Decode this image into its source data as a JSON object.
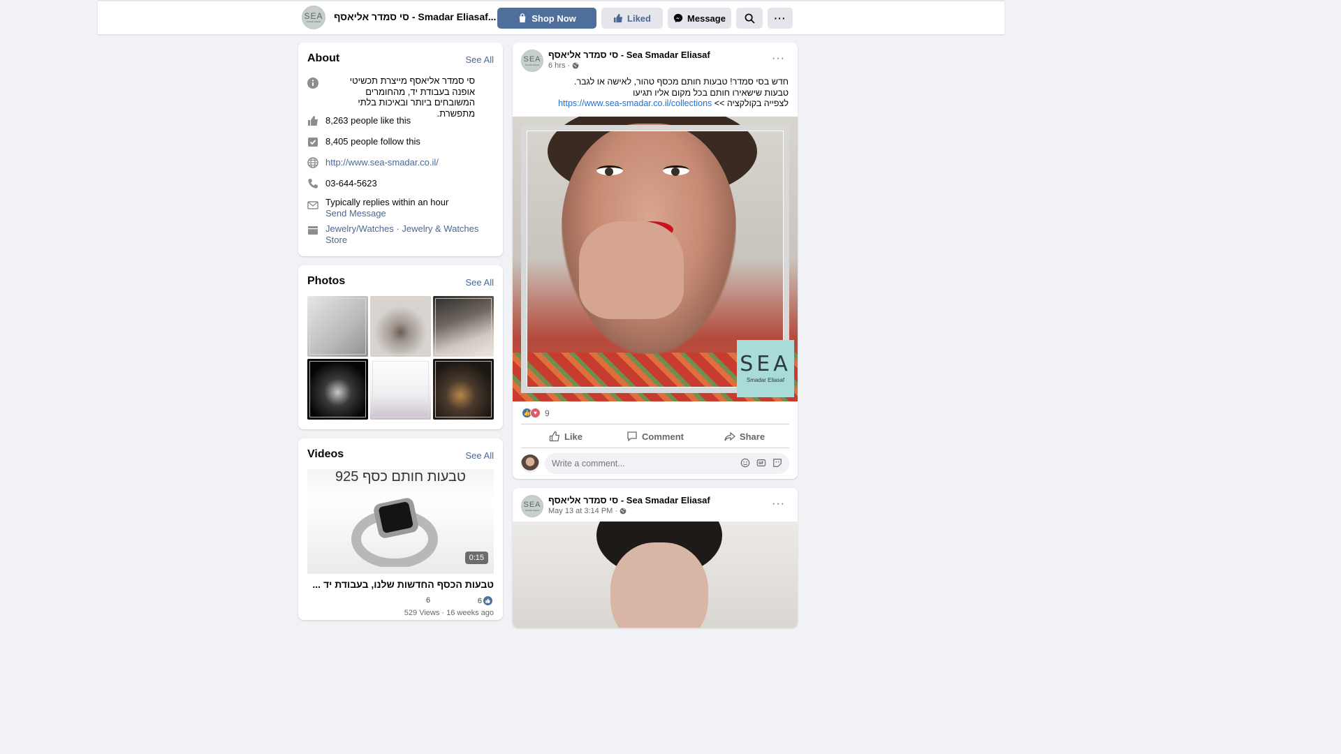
{
  "header": {
    "page_name": "סי סמדר אליאסף - Smadar Eliasaf...",
    "avatar_text": "SEA",
    "avatar_sub": "Smadar Eliasaf",
    "buttons": {
      "shop": "Shop Now",
      "liked": "Liked",
      "message": "Message"
    },
    "accent_color": "#4e6f9b"
  },
  "about": {
    "title": "About",
    "see_all": "See All",
    "description": "סי סמדר אליאסף מייצרת תכשיטי אופנה בעבודת יד, מהחומרים המשובחים ביותר ובאיכות בלתי מתפשרת.",
    "likes": "8,263 people like this",
    "follows": "8,405 people follow this",
    "website": "http://www.sea-smadar.co.il/",
    "phone": "03-644-5623",
    "reply": "Typically replies within an hour",
    "send_message": "Send Message",
    "category_1": "Jewelry/Watches",
    "category_sep": " · ",
    "category_2": "Jewelry & Watches Store"
  },
  "photos": {
    "title": "Photos",
    "see_all": "See All"
  },
  "videos": {
    "title": "Videos",
    "see_all": "See All",
    "thumb_text": "טבעות חותם כסף 925",
    "duration": "0:15",
    "video_title": "טבעות הכסף החדשות שלנו, בעבודת יד ...",
    "likes": "6",
    "comments": "6",
    "stats": "529 Views · 16 weeks ago"
  },
  "post1": {
    "author": "סי סמדר אליאסף - Sea Smadar Eliasaf",
    "time": "6 hrs",
    "line1": "חדש בסי סמדר! טבעות חותם מכסף טהור, לאישה או לגבר.",
    "line2": "טבעות שישאירו חותם בכל מקום אליו תגיעו",
    "line3_prefix": "לצפייה בקולקציה >> ",
    "link": "https://www.sea-smadar.co.il/collections",
    "image_logo": "SEA",
    "image_logo_sub": "Smadar Eliasaf",
    "reaction_count": "9",
    "actions": {
      "like": "Like",
      "comment": "Comment",
      "share": "Share"
    },
    "comment_placeholder": "Write a comment..."
  },
  "post2": {
    "author": "סי סמדר אליאסף - Sea Smadar Eliasaf",
    "time": "May 13 at 3:14 PM"
  }
}
